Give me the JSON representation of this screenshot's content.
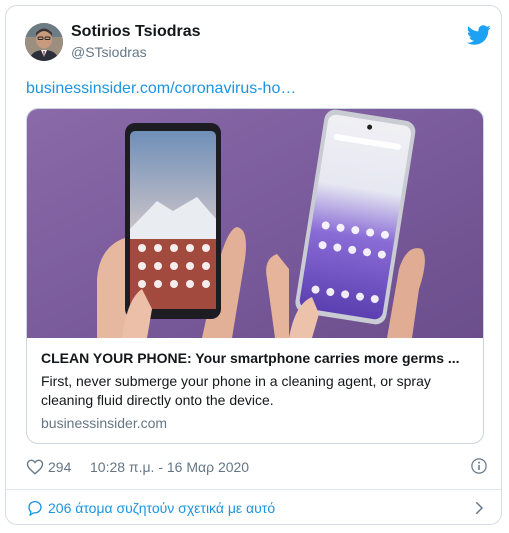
{
  "tweet": {
    "author_name": "Sotirios Tsiodras",
    "author_handle": "@STsiodras",
    "link_text": "businessinsider.com/coronavirus-ho…",
    "likes": "294",
    "timestamp": "10:28 π.μ. - 16 Μαρ 2020"
  },
  "card": {
    "title": "CLEAN YOUR PHONE: Your smartphone carries more germs ...",
    "description": "First, never submerge your phone in a cleaning agent, or spray cleaning fluid directly onto the device.",
    "domain": "businessinsider.com"
  },
  "footer": {
    "discussion_text": "206 άτομα συζητούν σχετικά με αυτό"
  },
  "icons": {
    "brand": "twitter-bird-icon",
    "like": "heart-icon",
    "info": "info-icon",
    "reply": "speech-bubble-icon",
    "chevron": "chevron-right-icon"
  },
  "colors": {
    "link": "#1b95e0",
    "text": "#14171a",
    "secondary": "#657786",
    "border": "#ccd6dd",
    "image_background": "#7d5fa0"
  }
}
